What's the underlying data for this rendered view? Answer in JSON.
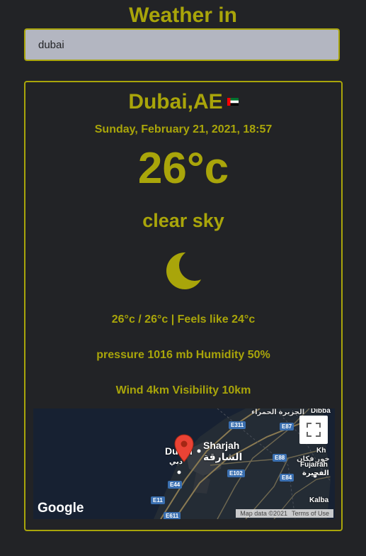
{
  "header": {
    "title": "Weather in"
  },
  "search": {
    "value": "dubai"
  },
  "weather": {
    "city": "Dubai,AE",
    "date": "Sunday, February 21, 2021, 18:57",
    "temperature": "26°c",
    "description": "clear sky",
    "minmax_feels": "26°c / 26°c | Feels like 24°c",
    "pressure_humidity": "pressure 1016 mb Humidity 50%",
    "wind_visibility": "Wind 4km Visibility 10km"
  },
  "map": {
    "logo": "Google",
    "attribution_data": "Map data ©2021",
    "attribution_terms": "Terms of Use",
    "labels": {
      "dubai": "Dubai",
      "dubai_ar": "دبي",
      "sharjah": "Sharjah",
      "sharjah_ar": "الشارقة",
      "fujairah": "Fujairah",
      "fujairah_ar": "الفجيرة",
      "kalba": "Kalba",
      "dibba": "Dibba",
      "khor_fakkan": "Kh",
      "khor_fakkan_ar": "خور فكان"
    },
    "roads": [
      "E311",
      "E87",
      "E88",
      "E102",
      "E84",
      "E44",
      "E11",
      "E611"
    ]
  },
  "colors": {
    "accent": "#a9a50a",
    "background": "#222326",
    "input_bg": "#b3b6c1",
    "map_bg": "#172132"
  },
  "icons": {
    "weather": "moon-crescent-icon",
    "flag": "uae-flag-icon",
    "map_pin": "map-pin-icon",
    "fullscreen": "fullscreen-icon"
  }
}
